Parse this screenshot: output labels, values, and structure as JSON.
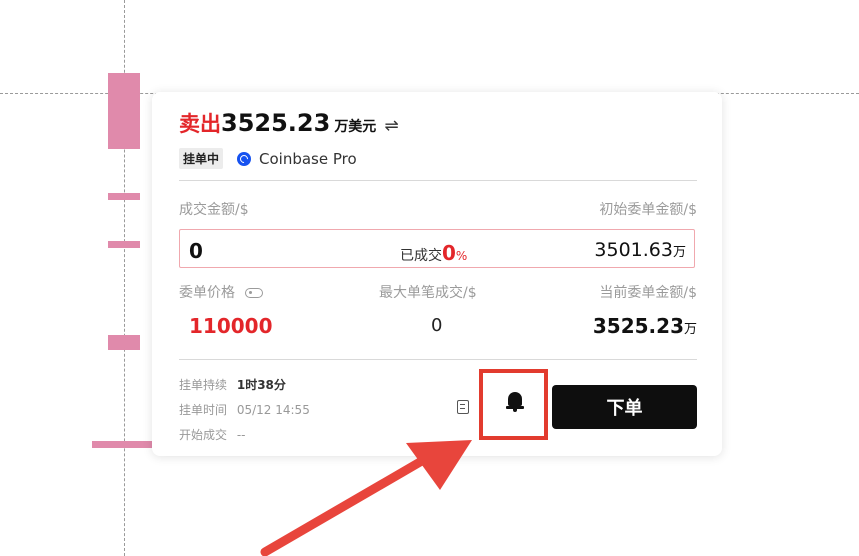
{
  "order": {
    "side": "卖出",
    "amount": "3525.23",
    "unit": "万美元",
    "status": "挂单中",
    "exchange": "Coinbase Pro"
  },
  "fields": {
    "filled_amount_label": "成交金额/$",
    "filled_amount_value": "0",
    "filled_text": "已成交",
    "filled_pct": "0",
    "pct_sign": "%",
    "initial_amount_label": "初始委单金额/$",
    "initial_amount_value": "3501.63",
    "wan": "万",
    "price_label": "委单价格",
    "price_value": "110000",
    "max_fill_label": "最大单笔成交/$",
    "max_fill_value": "0",
    "current_amount_label": "当前委单金额/$",
    "current_amount_value": "3525.23"
  },
  "footer": {
    "duration_label": "挂单持续",
    "duration_value": "1时38分",
    "time_label": "挂单时间",
    "time_value": "05/12 14:55",
    "start_label": "开始成交",
    "start_value": "--"
  },
  "actions": {
    "order_button": "下单"
  },
  "colors": {
    "sell": "#e3262a",
    "highlight_box": "#e23b2e",
    "arrow": "#e8453c",
    "bars": "#e08aab"
  }
}
